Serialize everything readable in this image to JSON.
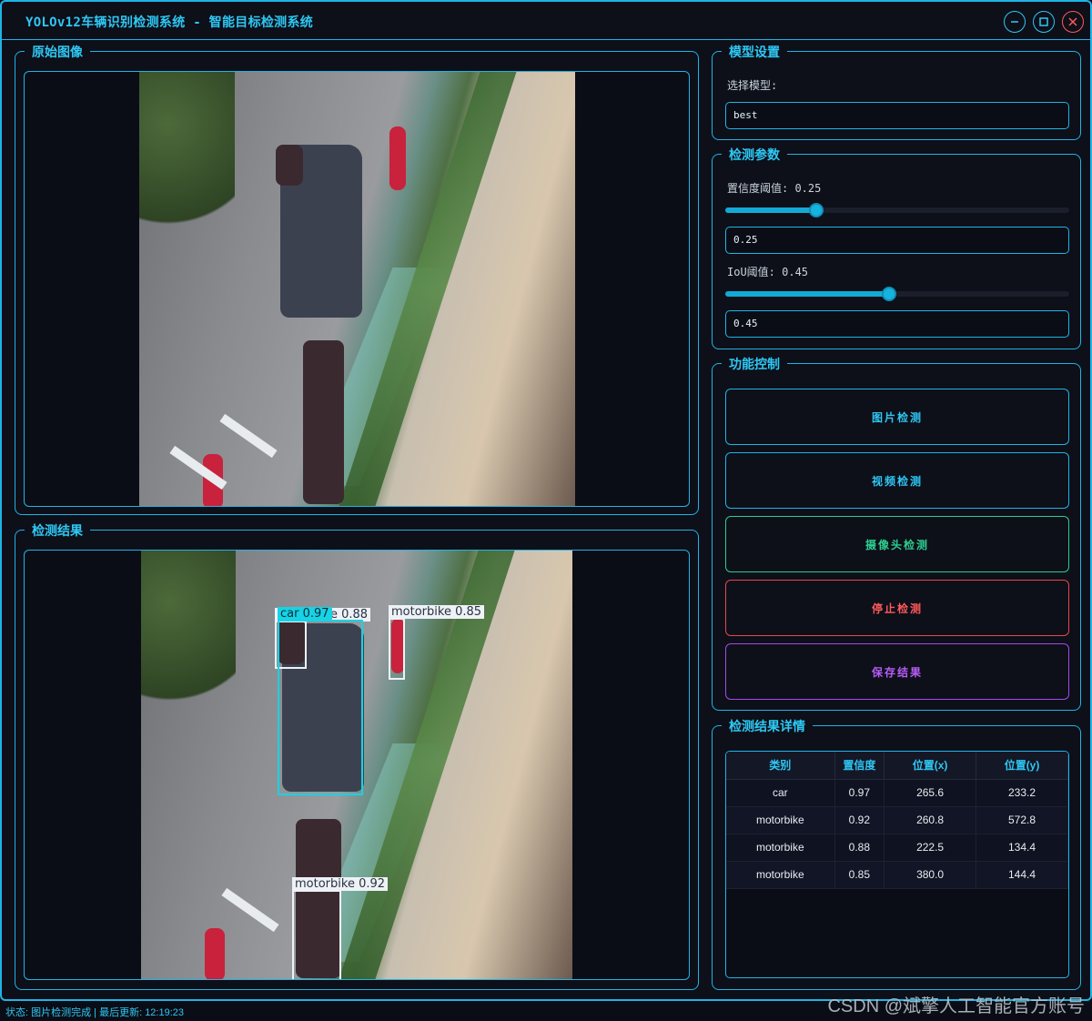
{
  "window": {
    "title": "YOLOv12车辆识别检测系统 - 智能目标检测系统"
  },
  "panels": {
    "original_image_title": "原始图像",
    "result_image_title": "检测结果",
    "model_settings_title": "模型设置",
    "detect_params_title": "检测参数",
    "function_control_title": "功能控制",
    "result_details_title": "检测结果详情"
  },
  "model": {
    "select_label": "选择模型:",
    "selected": "best"
  },
  "params": {
    "confidence_label": "置信度阈值: 0.25",
    "confidence_value": "0.25",
    "confidence_fraction": 0.25,
    "iou_label": "IoU阈值: 0.45",
    "iou_value": "0.45",
    "iou_fraction": 0.45
  },
  "buttons": {
    "image_detect": "图片检测",
    "video_detect": "视频检测",
    "camera_detect": "摄像头检测",
    "stop_detect": "停止检测",
    "save_result": "保存结果"
  },
  "colors": {
    "accent": "#1fb4e6",
    "image_btn": "#1fb4e6",
    "video_btn": "#1fb4e6",
    "camera_btn": "#2ecc8f",
    "stop_btn": "#e8474c",
    "save_btn": "#a64ae8",
    "box_car": "#16d3e6",
    "box_motorbike": "#eef2f6"
  },
  "detections_overlay": [
    {
      "label": "motorbike  0.88"
    },
    {
      "label": "car  0.97"
    },
    {
      "label": "motorbike  0.85"
    },
    {
      "label": "motorbike  0.92"
    }
  ],
  "results_table": {
    "headers": [
      "类别",
      "置信度",
      "位置(x)",
      "位置(y)"
    ],
    "rows": [
      [
        "car",
        "0.97",
        "265.6",
        "233.2"
      ],
      [
        "motorbike",
        "0.92",
        "260.8",
        "572.8"
      ],
      [
        "motorbike",
        "0.88",
        "222.5",
        "134.4"
      ],
      [
        "motorbike",
        "0.85",
        "380.0",
        "144.4"
      ]
    ]
  },
  "status": "状态: 图片检测完成 | 最后更新: 12:19:23",
  "watermark": "CSDN @斌擎人工智能官方账号"
}
